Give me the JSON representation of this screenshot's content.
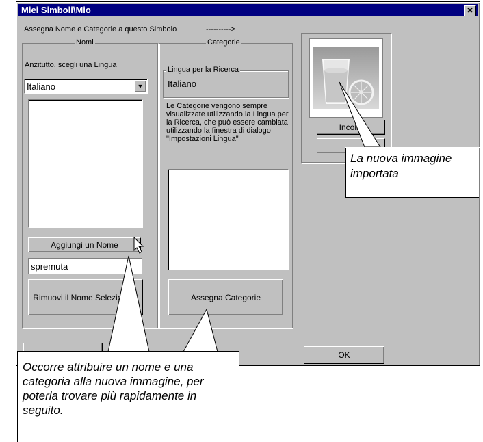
{
  "window": {
    "title": "Miei Simboli\\Mio",
    "close": "✕"
  },
  "header": {
    "assign_text": "Assegna Nome e Categorie a questo Simbolo",
    "arrow": "---------->"
  },
  "names": {
    "group_title": "Nomi",
    "choose_language": "Anzitutto, scegli una Lingua",
    "language_value": "Italiano",
    "add_button": "Aggiungi un Nome",
    "name_input": "spremuta",
    "remove_button": "Rimuovi il Nome Selezionato"
  },
  "categories": {
    "group_title": "Categorie",
    "search_lang_title": "Lingua per la Ricerca",
    "search_lang_value": "Italiano",
    "info_text": "Le Categorie vengono sempre visualizzate utilizzando la Lingua per la Ricerca, che può essere cambiata utilizzando la finestra di dialogo \"Impostazioni Lingua\"",
    "assign_button": "Assegna Categorie"
  },
  "image_panel": {
    "paste_button": "Incolla",
    "second_button": ""
  },
  "footer": {
    "ok_button": "OK"
  },
  "callouts": {
    "image": "La nuova immagine importata",
    "name": "Occorre attribuire un nome e una categoria alla nuova immagine, per poterla trovare più rapidamente in seguito."
  }
}
